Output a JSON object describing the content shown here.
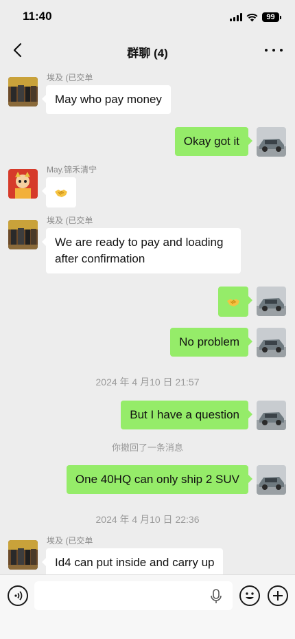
{
  "status_bar": {
    "time": "11:40",
    "battery": "99"
  },
  "nav": {
    "title": "群聊 (4)"
  },
  "messages": {
    "m1": {
      "sender": "埃及 (已交单",
      "text": "May who pay money"
    },
    "m2": {
      "text": "Okay got it"
    },
    "m3": {
      "sender": "May.锦禾清宁",
      "emoji": "handshake-emoji"
    },
    "m4": {
      "sender": "埃及 (已交单",
      "text": "We are ready to pay and loading after confirmation"
    },
    "m5": {
      "emoji": "handshake-emoji"
    },
    "m6": {
      "text": "No problem"
    },
    "t1": "2024 年 4 月10 日 21:57",
    "m7": {
      "text": "But I have a question"
    },
    "recall": "你撤回了一条消息",
    "m8": {
      "text": "One 40HQ can only ship 2 SUV"
    },
    "t2": "2024 年 4 月10 日 22:36",
    "m9": {
      "sender": "埃及 (已交单",
      "text": "Id4 can put inside and carry up"
    }
  },
  "input": {
    "placeholder": ""
  },
  "colors": {
    "background": "#ededed",
    "outgoing_bubble": "#95ec69",
    "incoming_bubble": "#ffffff"
  },
  "icons": [
    "back-chevron-icon",
    "more-dots-icon",
    "voice-icon",
    "mic-icon",
    "emoji-icon",
    "plus-icon",
    "signal-icon",
    "wifi-icon",
    "battery-icon"
  ]
}
